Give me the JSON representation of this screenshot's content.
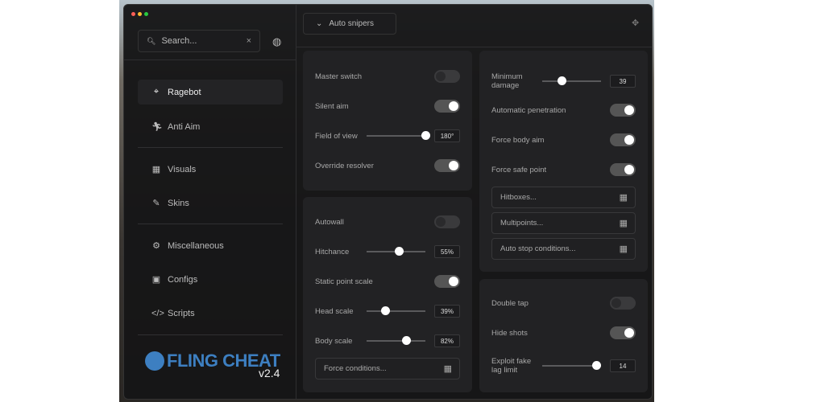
{
  "colors": {
    "accent": "#3d7fc1",
    "close": "#ff5f57",
    "minimize": "#febc2e",
    "maximize": "#28c840"
  },
  "search": {
    "placeholder": "Search...",
    "clear": "×"
  },
  "sidebar": {
    "items": [
      {
        "label": "Ragebot",
        "icon": "crosshair-icon",
        "active": true
      },
      {
        "label": "Anti Aim",
        "icon": "running-icon"
      },
      {
        "label": "Visuals",
        "icon": "visuals-icon"
      },
      {
        "label": "Skins",
        "icon": "brush-icon"
      },
      {
        "label": "Miscellaneous",
        "icon": "gear-icon"
      },
      {
        "label": "Configs",
        "icon": "save-icon"
      },
      {
        "label": "Scripts",
        "icon": "code-icon"
      }
    ]
  },
  "logo": {
    "text": "FLING CHEAT",
    "version": "v2.4"
  },
  "header": {
    "weapon_dropdown": "Auto snipers"
  },
  "panel1": {
    "master_switch": "Master switch",
    "silent_aim": "Silent aim",
    "fov": "Field of view",
    "fov_value": "180°",
    "fov_fill": 1.0,
    "override_resolver": "Override resolver"
  },
  "panel2": {
    "autowall": "Autowall",
    "hitchance": "Hitchance",
    "hitchance_value": "55%",
    "hitchance_fill": 0.55,
    "static_point_scale": "Static point scale",
    "head_scale": "Head scale",
    "head_value": "39%",
    "head_fill": 0.31,
    "body_scale": "Body scale",
    "body_value": "82%",
    "body_fill": 0.67,
    "force_conditions": "Force conditions..."
  },
  "panel3": {
    "min_damage": "Minimum damage",
    "min_damage_value": "39",
    "min_damage_fill": 0.33,
    "auto_pen": "Automatic penetration",
    "force_body": "Force body aim",
    "force_safe": "Force safe point",
    "hitboxes": "Hitboxes...",
    "multipoints": "Multipoints...",
    "auto_stop": "Auto stop conditions..."
  },
  "panel4": {
    "double_tap": "Double tap",
    "hide_shots": "Hide shots",
    "fake_lag": "Exploit fake lag limit",
    "fake_lag_value": "14",
    "fake_lag_fill": 0.92
  },
  "toggles": {
    "master_switch": false,
    "silent_aim": true,
    "override_resolver": true,
    "autowall": false,
    "static_point_scale": true,
    "auto_pen": true,
    "force_body": true,
    "force_safe": true,
    "double_tap": false,
    "hide_shots": true
  }
}
